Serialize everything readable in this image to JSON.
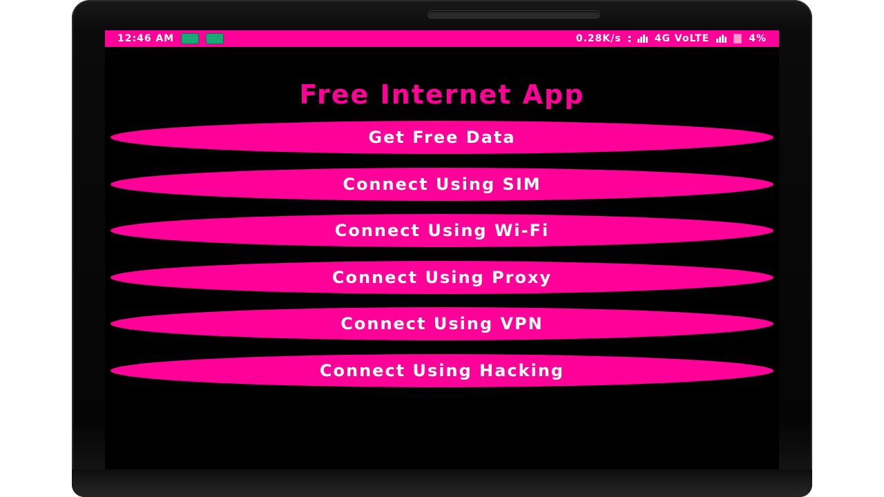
{
  "colors": {
    "accent": "#ff0099",
    "button_text": "#ffffff",
    "screen_background": "#000000"
  },
  "status_bar": {
    "time": "12:46 AM",
    "notification_icons": [
      "whatsapp-icon",
      "app-notification-icon"
    ],
    "speed": "0.28K/s",
    "network": "4G VoLTE",
    "battery": "4%"
  },
  "app": {
    "title": "Free Internet App"
  },
  "buttons": [
    {
      "label": "Get Free Data"
    },
    {
      "label": "Connect Using SIM"
    },
    {
      "label": "Connect Using Wi-Fi"
    },
    {
      "label": "Connect Using Proxy"
    },
    {
      "label": "Connect Using VPN"
    },
    {
      "label": "Connect Using Hacking"
    }
  ]
}
